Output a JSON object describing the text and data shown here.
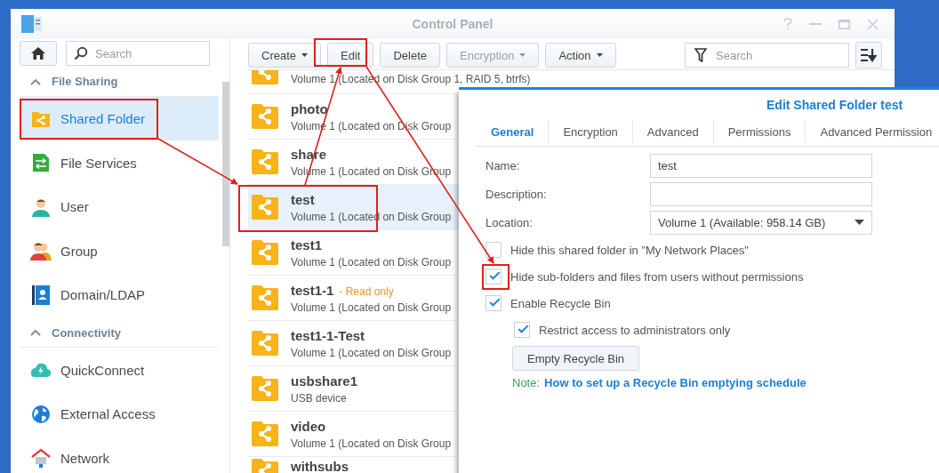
{
  "window": {
    "title": "Control Panel"
  },
  "sidebar": {
    "search": {
      "placeholder": "Search"
    },
    "sections": [
      {
        "title": "File Sharing",
        "expanded": true,
        "items": [
          {
            "label": "Shared Folder",
            "selected": true
          },
          {
            "label": "File Services",
            "selected": false
          },
          {
            "label": "User",
            "selected": false
          },
          {
            "label": "Group",
            "selected": false
          },
          {
            "label": "Domain/LDAP",
            "selected": false
          }
        ]
      },
      {
        "title": "Connectivity",
        "expanded": true,
        "items": [
          {
            "label": "QuickConnect",
            "selected": false
          },
          {
            "label": "External Access",
            "selected": false
          },
          {
            "label": "Network",
            "selected": false
          }
        ]
      }
    ]
  },
  "toolbar": {
    "buttons": [
      {
        "label": "Create",
        "dropdown": true,
        "disabled": false
      },
      {
        "label": "Edit",
        "dropdown": false,
        "disabled": false
      },
      {
        "label": "Delete",
        "dropdown": false,
        "disabled": false
      },
      {
        "label": "Encryption",
        "dropdown": true,
        "disabled": true
      },
      {
        "label": "Action",
        "dropdown": true,
        "disabled": false
      }
    ],
    "filter": {
      "placeholder": "Search"
    }
  },
  "folders": [
    {
      "kind": "partial",
      "subtitle": "Volume 1 (Located on Disk Group 1, RAID 5, btrfs)",
      "selected": false
    },
    {
      "kind": "full",
      "name": "photo",
      "subtitle": "Volume 1 (Located on Disk Group",
      "selected": false
    },
    {
      "kind": "full",
      "name": "share",
      "subtitle": "Volume 1 (Located on Disk Group",
      "selected": false
    },
    {
      "kind": "full",
      "name": "test",
      "subtitle": "Volume 1 (Located on Disk Group",
      "selected": true
    },
    {
      "kind": "full",
      "name": "test1",
      "subtitle": "Volume 1 (Located on Disk Group",
      "selected": false
    },
    {
      "kind": "full",
      "name": "test1-1",
      "tag": "- Read only",
      "subtitle": "Volume 1 (Located on Disk Group",
      "selected": false
    },
    {
      "kind": "full",
      "name": "test1-1-Test",
      "subtitle": "Volume 1 (Located on Disk Group",
      "selected": false
    },
    {
      "kind": "full",
      "name": "usbshare1",
      "subtitle": "USB device",
      "selected": false
    },
    {
      "kind": "full",
      "name": "video",
      "subtitle": "Volume 1 (Located on Disk Group",
      "selected": false
    },
    {
      "kind": "top",
      "name": "withsubs",
      "selected": false
    }
  ],
  "dialog": {
    "title": "Edit Shared Folder test",
    "tabs": [
      {
        "label": "General",
        "selected": true
      },
      {
        "label": "Encryption",
        "selected": false
      },
      {
        "label": "Advanced",
        "selected": false
      },
      {
        "label": "Permissions",
        "selected": false
      },
      {
        "label": "Advanced Permission",
        "selected": false
      }
    ],
    "fields": [
      {
        "kind": "text",
        "label": "Name:",
        "value": "test"
      },
      {
        "kind": "text",
        "label": "Description:"
      },
      {
        "kind": "select",
        "label": "Location:",
        "value": "Volume 1 (Available: 958.14 GB)"
      }
    ],
    "options": [
      {
        "label": "Hide this shared folder in \"My Network Places\"",
        "checked": false
      },
      {
        "label": "Hide sub-folders and files from users without permissions",
        "checked": true
      },
      {
        "label": "Enable Recycle Bin",
        "checked": true,
        "children": [
          {
            "label": "Restrict access to administrators only",
            "checked": true
          }
        ]
      }
    ],
    "button": "Empty Recycle Bin",
    "note": {
      "label": "Note:",
      "link": "How to set up a Recycle Bin emptying schedule"
    }
  }
}
